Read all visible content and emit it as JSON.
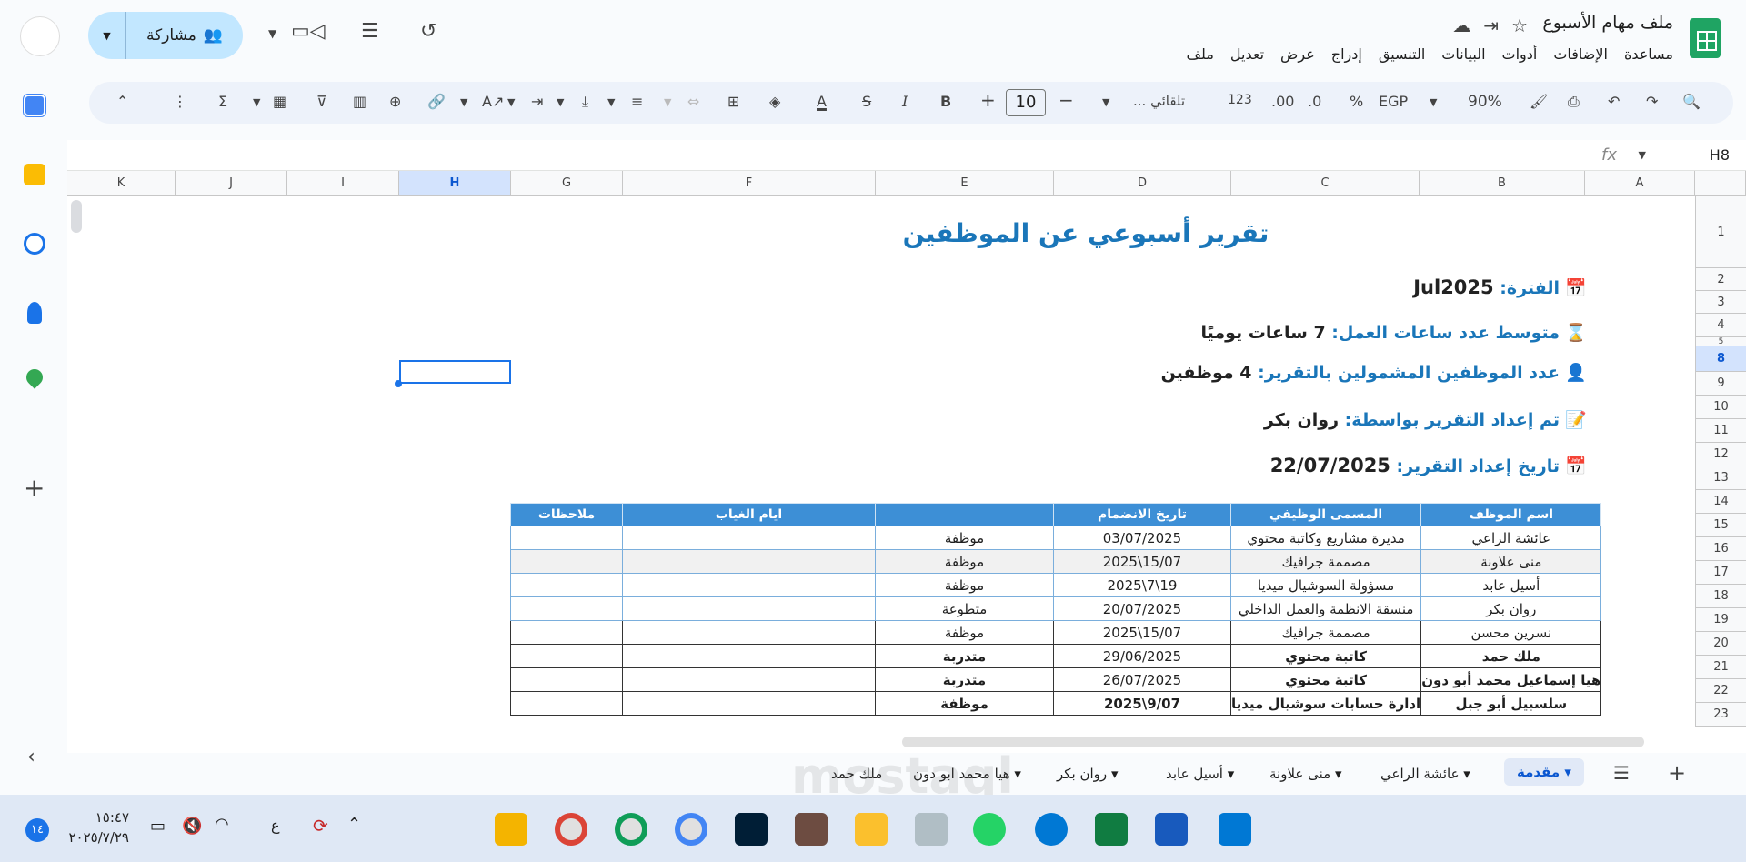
{
  "document": {
    "title": "ملف مهام الأسبوع",
    "menu": [
      "ملف",
      "تعديل",
      "عرض",
      "إدراج",
      "التنسيق",
      "البيانات",
      "أدوات",
      "الإضافات",
      "مساعدة"
    ],
    "share_label": "مشاركة"
  },
  "toolbar": {
    "zoom": "90%",
    "currency": "EGP",
    "percent": "%",
    "dec_decrease": ".0",
    "dec_increase": ".00",
    "num_format": "123",
    "font": "تلقائي ...",
    "font_size": "10",
    "minus": "−",
    "plus": "+"
  },
  "formula_bar": {
    "cell_ref": "H8",
    "fx": "fx"
  },
  "columns": [
    "A",
    "B",
    "C",
    "D",
    "E",
    "F",
    "G",
    "H",
    "I",
    "J",
    "K"
  ],
  "selected_column": "H",
  "rows": [
    "1",
    "2",
    "3",
    "4",
    "5",
    "8",
    "9",
    "10",
    "11",
    "12",
    "13",
    "14",
    "15",
    "16",
    "17",
    "18",
    "19",
    "20",
    "21",
    "22",
    "23"
  ],
  "selected_row": "8",
  "report": {
    "title": "تقرير أسبوعي عن الموظفين",
    "period_label": "الفترة:",
    "period_value": "Jul2025",
    "hours_label": "متوسط عدد ساعات العمل:",
    "hours_value": "7 ساعات يوميًا",
    "count_label": "عدد الموظفين المشمولين بالتقرير:",
    "count_value": "4 موظفين",
    "prepared_label": "تم إعداد التقرير بواسطة:",
    "prepared_value": "روان بكر",
    "date_label": "تاريخ إعداد التقرير:",
    "date_value": "22/07/2025"
  },
  "table": {
    "headers": [
      "اسم الموظف",
      "المسمى الوظيفي",
      "تاريخ الانضمام",
      "",
      "ايام الغياب",
      "ملاحظات"
    ],
    "rows": [
      [
        "عائشة الراعي",
        "مديرة مشاريع وكاتبة محتوي",
        "03/07/2025",
        "موظفة",
        "",
        ""
      ],
      [
        "منى علاونة",
        "مصممة جرافيك",
        "15/07\\2025",
        "موظفة",
        "",
        ""
      ],
      [
        "أسيل عابد",
        "مسؤولة السوشيال ميديا",
        "19\\7\\2025",
        "موظفة",
        "",
        ""
      ],
      [
        "روان بكر",
        "منسقة الانظمة والعمل الداخلي",
        "20/07/2025",
        "متطوعة",
        "",
        ""
      ],
      [
        "نسرين محسن",
        "مصممة جرافيك",
        "15/07\\2025",
        "موظفة",
        "",
        ""
      ],
      [
        "ملك حمد",
        "كاتبة محتوي",
        "29/06/2025",
        "متدربة",
        "",
        ""
      ],
      [
        "هيا إسماعيل محمد أبو دون",
        "كاتبة محتوي",
        "26/07/2025",
        "متدربة",
        "",
        ""
      ],
      [
        "سلسبيل أبو جبل",
        "ادارة حسابات سوشيال ميديا",
        "9/07\\2025",
        "موظفة",
        "",
        ""
      ]
    ]
  },
  "sheet_tabs": [
    "مقدمة",
    "عائشة الراعي",
    "منى علاونة",
    "أسيل عابد",
    "روان بكر",
    "هيا محمد ابو دون",
    "ملك حمد"
  ],
  "active_tab": "مقدمة",
  "taskbar": {
    "time": "١٥:٤٧",
    "date": "٢٠٢٥/٧/٢٩",
    "lang": "ع",
    "badge": "١٤"
  },
  "watermark": "mostaql"
}
